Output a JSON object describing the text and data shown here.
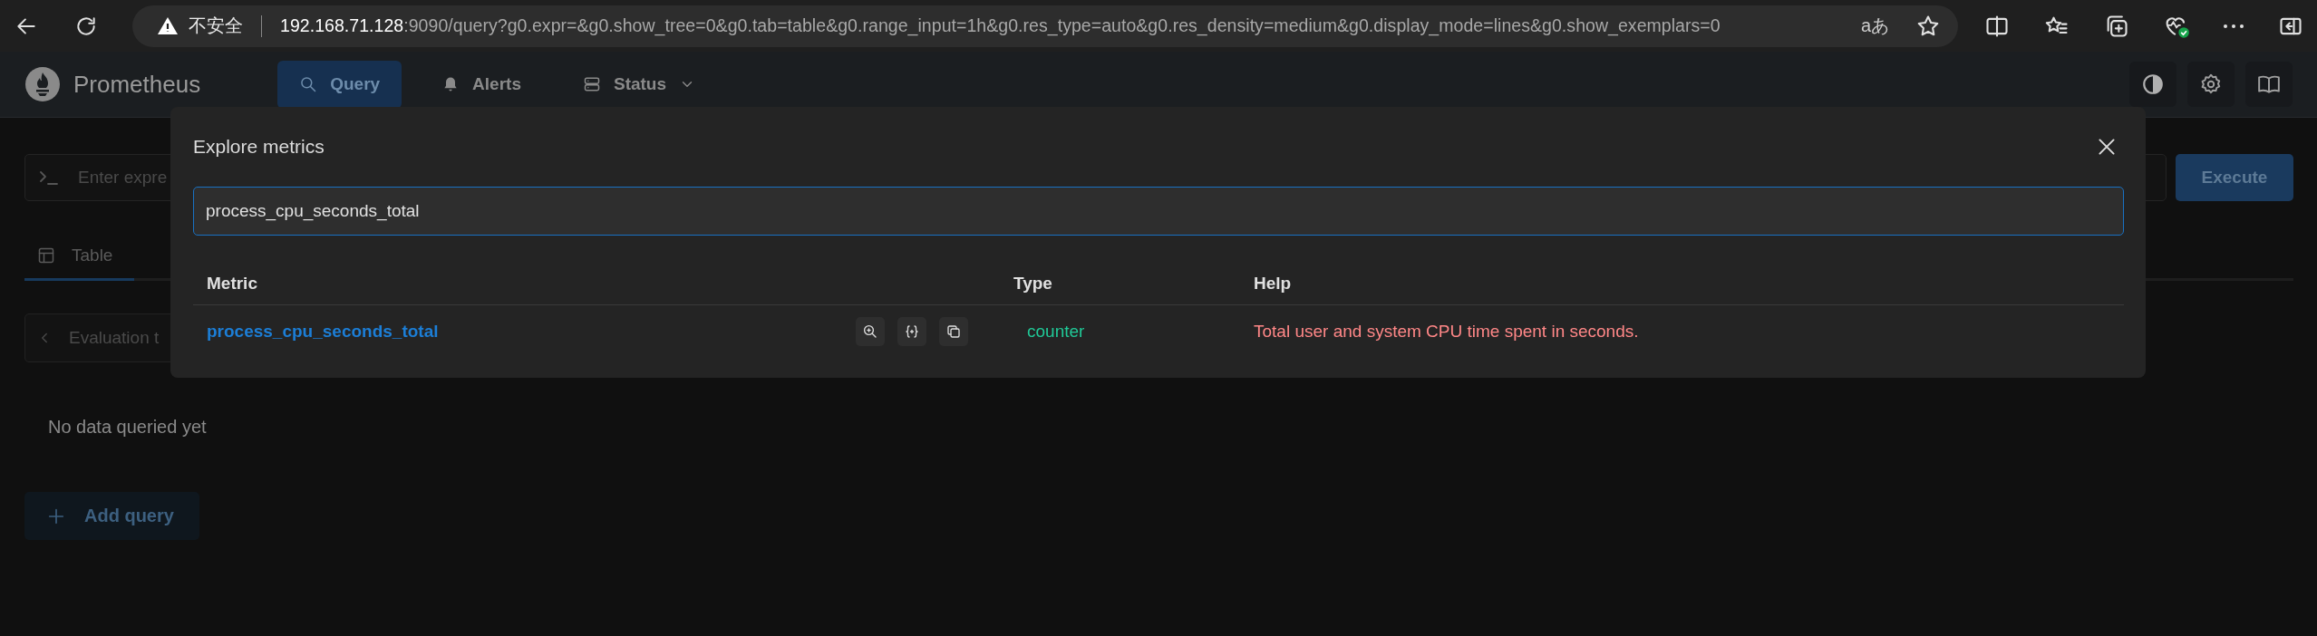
{
  "browser": {
    "security_label": "不安全",
    "url_host": "192.168.71.128",
    "url_rest": ":9090/query?g0.expr=&g0.show_tree=0&g0.tab=table&g0.range_input=1h&g0.res_type=auto&g0.res_density=medium&g0.display_mode=lines&g0.show_exemplars=0",
    "reader_label": "aあ"
  },
  "header": {
    "brand": "Prometheus",
    "nav": [
      {
        "label": "Query",
        "selected": true,
        "dropdown": false
      },
      {
        "label": "Alerts",
        "selected": false,
        "dropdown": false
      },
      {
        "label": "Status",
        "selected": false,
        "dropdown": true
      }
    ]
  },
  "query_panel": {
    "expression_placeholder": "Enter expre",
    "execute": "Execute",
    "tabs": [
      {
        "label": "Table",
        "selected": true
      }
    ],
    "evaluation_time_placeholder": "Evaluation t",
    "empty_message": "No data queried yet"
  },
  "add_query": "Add query",
  "modal": {
    "title": "Explore metrics",
    "search_value": "process_cpu_seconds_total",
    "columns": [
      "Metric",
      "Type",
      "Help"
    ],
    "rows": [
      {
        "metric": "process_cpu_seconds_total",
        "type": "counter",
        "help": "Total user and system CPU time spent in seconds."
      }
    ]
  }
}
